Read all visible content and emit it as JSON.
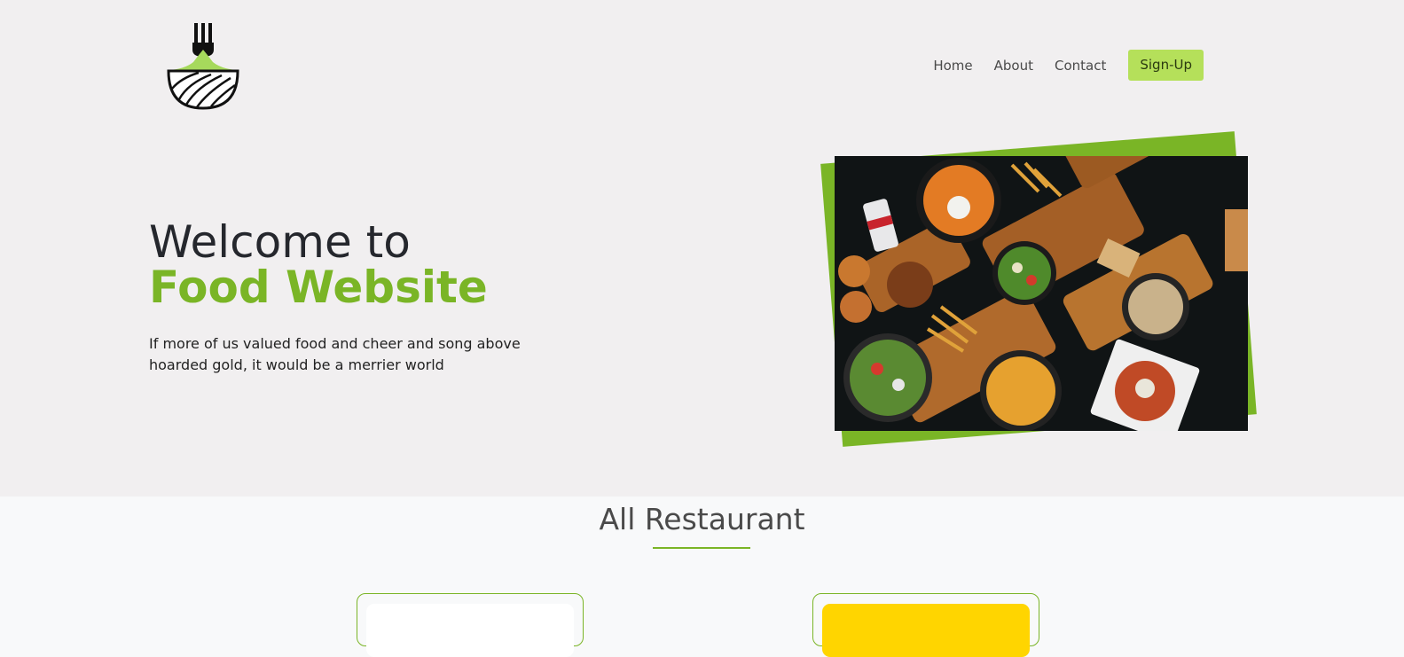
{
  "nav": {
    "links": [
      "Home",
      "About",
      "Contact"
    ],
    "signup_label": "Sign-Up"
  },
  "hero": {
    "title_line1": "Welcome to",
    "title_line2": "Food Website",
    "subtitle": "If more of us valued food and cheer and song above hoarded gold, it would be a merrier world"
  },
  "section": {
    "title": "All Restaurant"
  },
  "colors": {
    "accent": "#7ab526",
    "button": "#b5e05a",
    "hero_bg": "#f1eff0",
    "card2_fill": "#ffd500"
  },
  "icons": {
    "logo": "fork-bowl-logo",
    "hero_image": "food-spread-photo"
  }
}
